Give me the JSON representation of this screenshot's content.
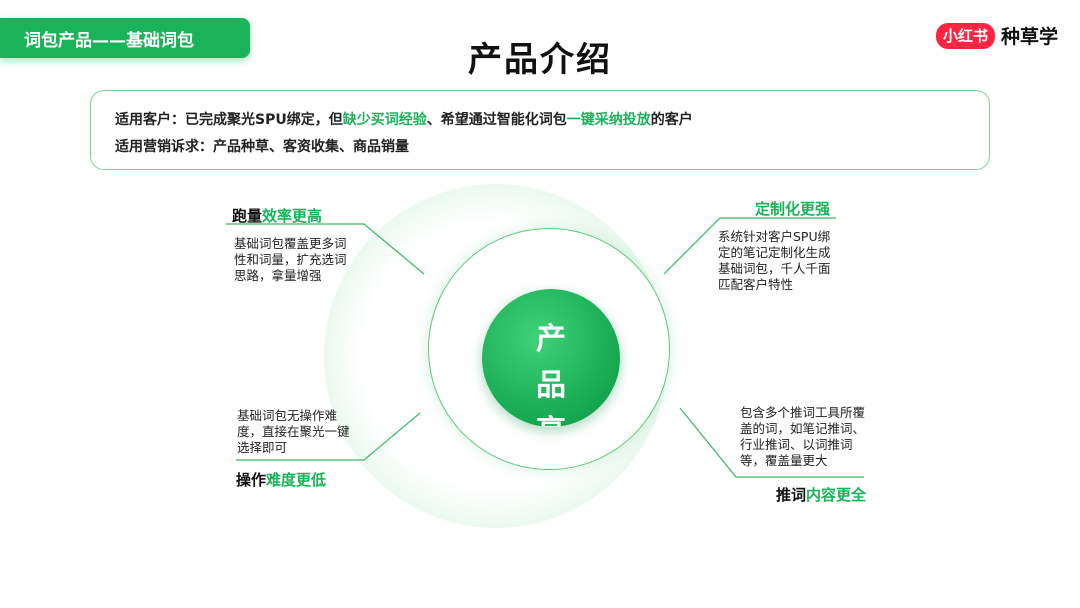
{
  "header": {
    "tag_label": "词包产品——基础词包",
    "title": "产品介绍",
    "logo_badge": "小红书",
    "logo_text": "种草学"
  },
  "info": {
    "line1_prefix": "适用客户：已完成聚光SPU绑定，但",
    "line1_hl1": "缺少买词经验",
    "line1_mid": "、希望通过智能化词包",
    "line1_hl2": "一键采纳投放",
    "line1_suffix": "的客户",
    "line2": "适用营销诉求：产品种草、客资收集、商品销量"
  },
  "center": {
    "text": "产品亮点"
  },
  "features": {
    "top_left": {
      "title_prefix": "跑量",
      "title_hl": "效率更高",
      "desc": "基础词包覆盖更多词性和词量，扩充选词思路，拿量增强"
    },
    "top_right": {
      "title_prefix": "",
      "title_hl": "定制化更强",
      "desc": "系统针对客户SPU绑定的笔记定制化生成基础词包，千人千面匹配客户特性"
    },
    "bottom_left": {
      "title_prefix": "操作",
      "title_hl": "难度更低",
      "desc": "基础词包无操作难度，直接在聚光一键选择即可"
    },
    "bottom_right": {
      "title_prefix": "推词",
      "title_hl": "内容更全",
      "desc": "包含多个推词工具所覆盖的词，如笔记推词、行业推词、以词推词等，覆盖量更大"
    }
  },
  "colors": {
    "accent": "#1bb35a",
    "brand_red": "#ff2442",
    "border_light": "#7ed39a"
  }
}
